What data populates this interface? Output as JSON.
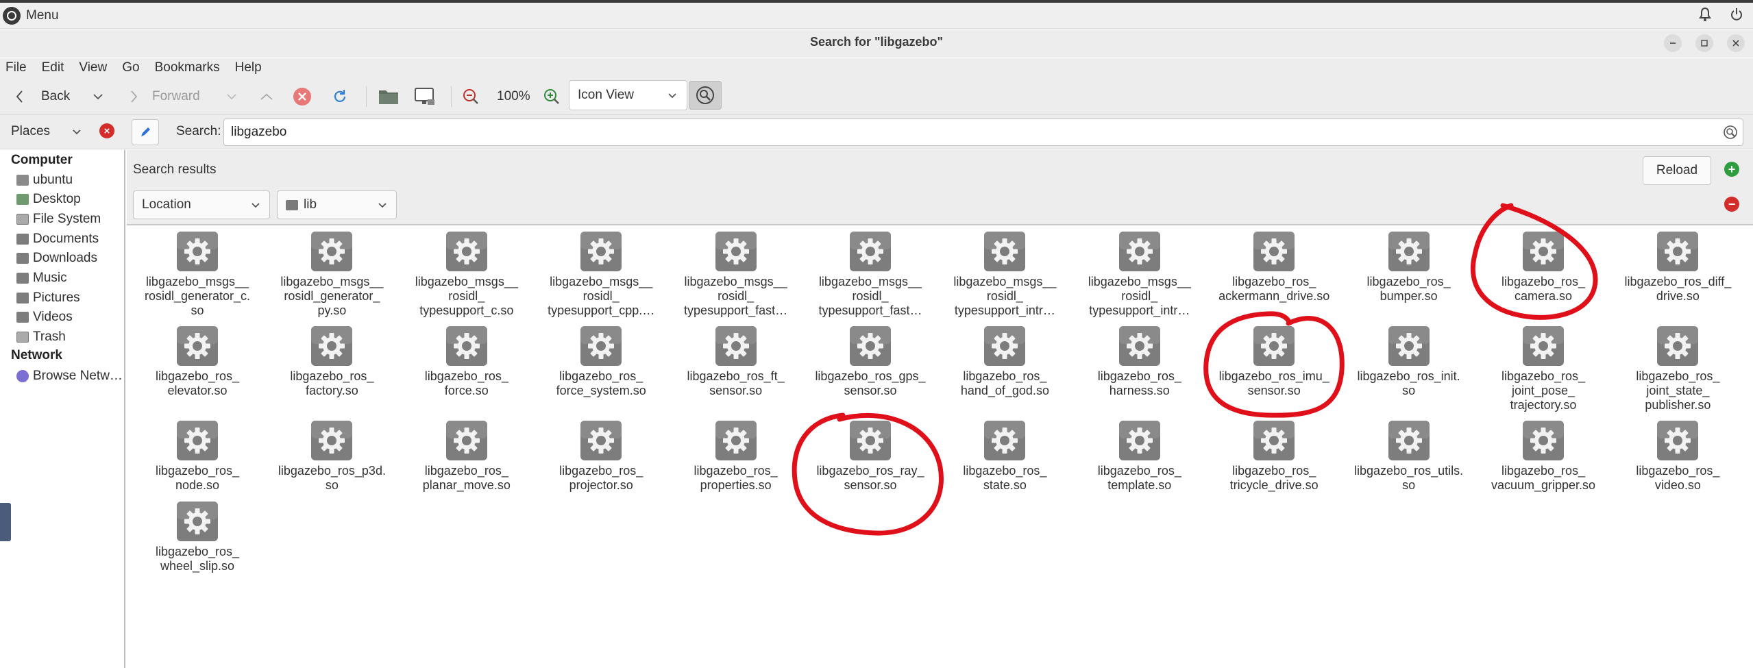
{
  "panel": {
    "menu_label": "Menu"
  },
  "window": {
    "title": "Search for \"libgazebo\""
  },
  "menubar": [
    "File",
    "Edit",
    "View",
    "Go",
    "Bookmarks",
    "Help"
  ],
  "toolbar": {
    "back": "Back",
    "forward": "Forward",
    "zoom": "100%",
    "view_mode": "Icon View"
  },
  "places": {
    "label": "Places"
  },
  "search": {
    "label": "Search:",
    "value": "libgazebo"
  },
  "sidebar": {
    "computer_heading": "Computer",
    "computer_items": [
      {
        "label": "ubuntu",
        "icon": "home-folder-icon"
      },
      {
        "label": "Desktop",
        "icon": "desktop-icon"
      },
      {
        "label": "File System",
        "icon": "drive-icon"
      },
      {
        "label": "Documents",
        "icon": "folder-icon"
      },
      {
        "label": "Downloads",
        "icon": "folder-icon"
      },
      {
        "label": "Music",
        "icon": "folder-icon"
      },
      {
        "label": "Pictures",
        "icon": "folder-icon"
      },
      {
        "label": "Videos",
        "icon": "folder-icon"
      },
      {
        "label": "Trash",
        "icon": "trash-icon"
      }
    ],
    "network_heading": "Network",
    "network_items": [
      {
        "label": "Browse Netw…",
        "icon": "network-icon"
      }
    ]
  },
  "criteria": {
    "title": "Search results",
    "reload": "Reload",
    "field": "Location",
    "location": "lib"
  },
  "files": [
    "libgazebo_msgs__\nrosidl_generator_c.\nso",
    "libgazebo_msgs__\nrosidl_generator_\npy.so",
    "libgazebo_msgs__\nrosidl_\ntypesupport_c.so",
    "libgazebo_msgs__\nrosidl_\ntypesupport_cpp.…",
    "libgazebo_msgs__\nrosidl_\ntypesupport_fast…",
    "libgazebo_msgs__\nrosidl_\ntypesupport_fast…",
    "libgazebo_msgs__\nrosidl_\ntypesupport_intr…",
    "libgazebo_msgs__\nrosidl_\ntypesupport_intr…",
    "libgazebo_ros_\nackermann_drive.so",
    "libgazebo_ros_\nbumper.so",
    "libgazebo_ros_\ncamera.so",
    "libgazebo_ros_diff_\ndrive.so",
    "libgazebo_ros_\nelevator.so",
    "libgazebo_ros_\nfactory.so",
    "libgazebo_ros_\nforce.so",
    "libgazebo_ros_\nforce_system.so",
    "libgazebo_ros_ft_\nsensor.so",
    "libgazebo_ros_gps_\nsensor.so",
    "libgazebo_ros_\nhand_of_god.so",
    "libgazebo_ros_\nharness.so",
    "libgazebo_ros_imu_\nsensor.so",
    "libgazebo_ros_init.\nso",
    "libgazebo_ros_\njoint_pose_\ntrajectory.so",
    "libgazebo_ros_\njoint_state_\npublisher.so",
    "libgazebo_ros_\nnode.so",
    "libgazebo_ros_p3d.\nso",
    "libgazebo_ros_\nplanar_move.so",
    "libgazebo_ros_\nprojector.so",
    "libgazebo_ros_\nproperties.so",
    "libgazebo_ros_ray_\nsensor.so",
    "libgazebo_ros_\nstate.so",
    "libgazebo_ros_\ntemplate.so",
    "libgazebo_ros_\ntricycle_drive.so",
    "libgazebo_ros_utils.\nso",
    "libgazebo_ros_\nvacuum_gripper.so",
    "libgazebo_ros_\nvideo.so",
    "libgazebo_ros_\nwheel_slip.so"
  ],
  "annotation_color": "#e0101a"
}
